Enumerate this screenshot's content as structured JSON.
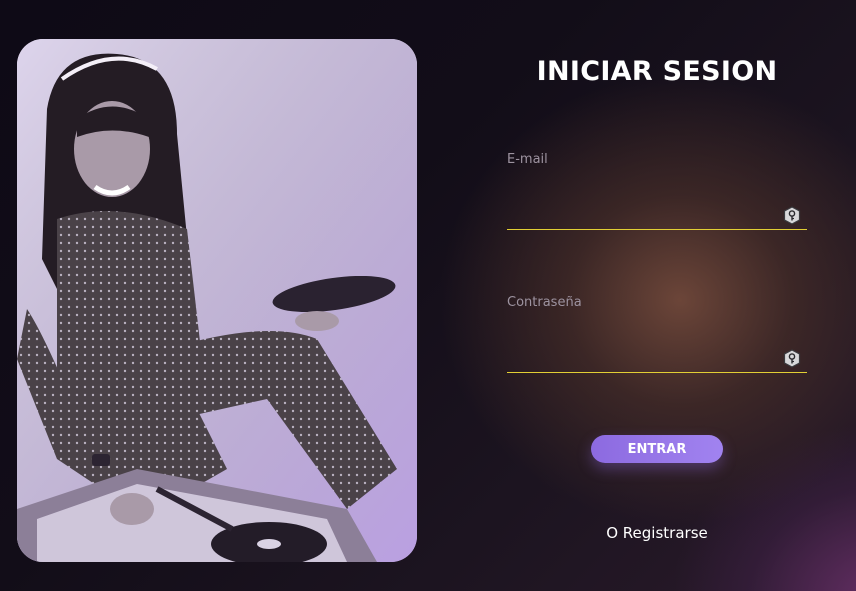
{
  "login": {
    "title": "INICIAR SESION",
    "email_label": "E-mail",
    "email_value": "",
    "password_label": "Contraseña",
    "password_value": "",
    "submit_label": "ENTRAR",
    "register_label": "O Registrarse"
  },
  "theme": {
    "accent": "#9677e8",
    "underline": "#e2cf34",
    "background": "#120d18"
  },
  "icons": {
    "field_icon": "key-icon"
  }
}
